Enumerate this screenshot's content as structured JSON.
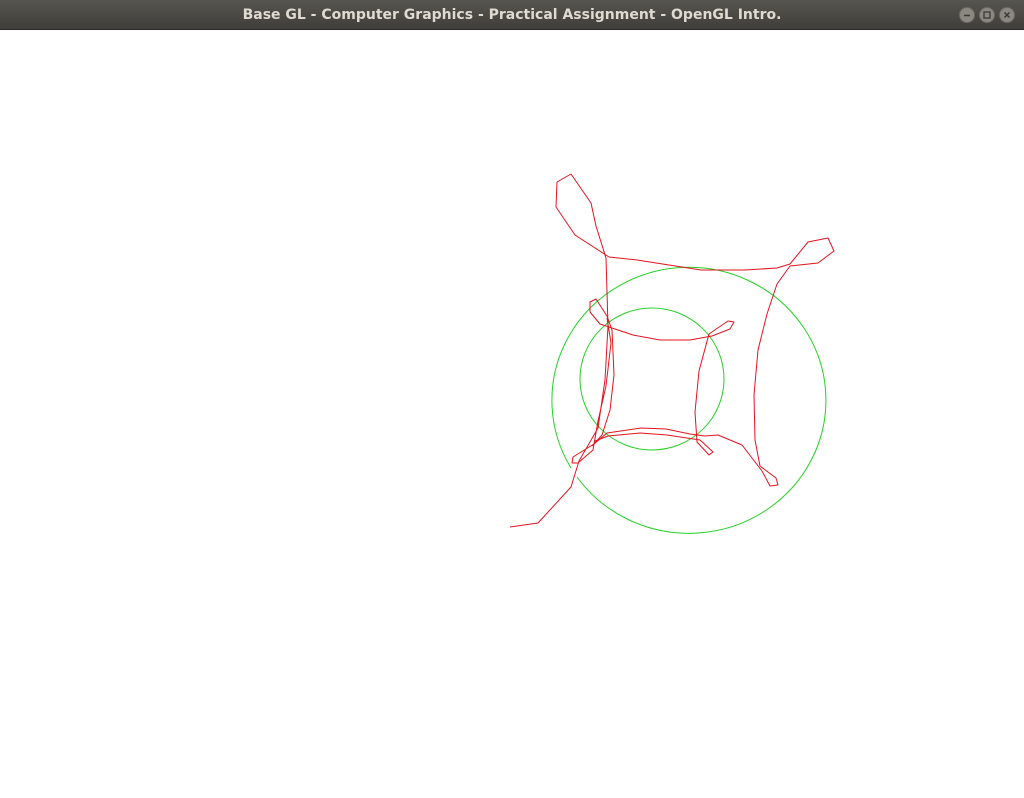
{
  "window": {
    "title": "Base GL - Computer Graphics - Practical Assignment - OpenGL Intro."
  },
  "controls": {
    "minimize": "minimize-icon",
    "maximize": "maximize-icon",
    "close": "close-icon"
  },
  "colors": {
    "curve": "#e0141e",
    "circle": "#25d025",
    "background": "#ffffff"
  }
}
